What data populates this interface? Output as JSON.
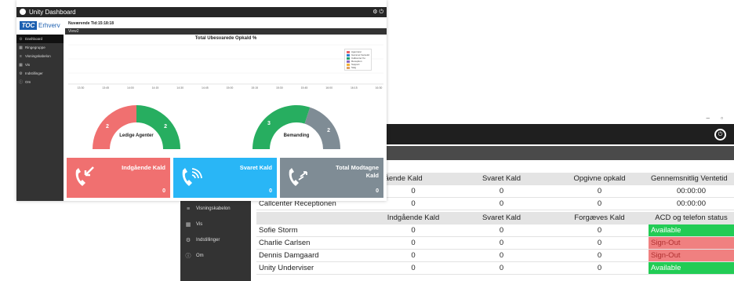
{
  "back_window": {
    "window_controls": "–   ▫",
    "sidebar": [
      {
        "icon": "≡",
        "label": "Visningskabelon"
      },
      {
        "icon": "▦",
        "label": "Vis"
      },
      {
        "icon": "⚙",
        "label": "Indstillinger"
      },
      {
        "icon": "ⓘ",
        "label": "Om"
      }
    ],
    "queue_table": {
      "headers": [
        "",
        "ngående Kald",
        "Svaret Kald",
        "Opgivne opkald",
        "Gennemsnitlig Ventetid"
      ],
      "rows": [
        [
          "",
          "0",
          "0",
          "0",
          "00:00:00"
        ],
        [
          "Callcenter Receptionen",
          "0",
          "0",
          "0",
          "00:00:00"
        ]
      ]
    },
    "agent_table": {
      "headers": [
        "",
        "Indgående Kald",
        "Svaret Kald",
        "Forgæves Kald",
        "ACD og telefon status"
      ],
      "rows": [
        {
          "name": "Sofie Storm",
          "in": "0",
          "answered": "0",
          "missed": "0",
          "status": "Available"
        },
        {
          "name": "Charlie Carlsen",
          "in": "0",
          "answered": "0",
          "missed": "0",
          "status": "Sign-Out"
        },
        {
          "name": "Dennis Damgaard",
          "in": "0",
          "answered": "0",
          "missed": "0",
          "status": "Sign-Out"
        },
        {
          "name": "Unity Underviser",
          "in": "0",
          "answered": "0",
          "missed": "0",
          "status": "Available"
        }
      ]
    }
  },
  "front_window": {
    "title": "Unity Dashboard",
    "logo": {
      "mark": "TOC",
      "text": "Erhverv"
    },
    "time_label": "Nuværende Tid:15:18:18",
    "view_label": "View2",
    "sidebar": [
      {
        "icon": "⊙",
        "label": "Dashboard"
      },
      {
        "icon": "▦",
        "label": "Ringegruppe"
      },
      {
        "icon": "≡",
        "label": "Visningskabelon"
      },
      {
        "icon": "▦",
        "label": "Vis"
      },
      {
        "icon": "⚙",
        "label": "Indstillinger"
      },
      {
        "icon": "ⓘ",
        "label": "Om"
      }
    ],
    "chart_title": "Total Ubesvarede Opkald %",
    "x_ticks": [
      "13:30",
      "13:45",
      "14:00",
      "14:15",
      "14:30",
      "14:45",
      "15:00",
      "15:15",
      "15:30",
      "15:45",
      "16:00",
      "16:15",
      "16:30"
    ],
    "legend": [
      {
        "label": "Agenturer",
        "color": "#e8656a"
      },
      {
        "label": "Gammel Ventetid",
        "color": "#2a7fd4"
      },
      {
        "label": "Callcenter Ko",
        "color": "#22a06b"
      },
      {
        "label": "Reception",
        "color": "#8a6bbf"
      },
      {
        "label": "Support",
        "color": "#f2b134"
      },
      {
        "label": "Salg",
        "color": "#e0a060"
      }
    ],
    "gauges": [
      {
        "label": "Ledige Agenter",
        "left": "2",
        "right": "2",
        "left_color": "#f07070",
        "right_color": "#27ae60",
        "fraction_left": 0.5
      },
      {
        "label": "Bemanding",
        "left": "3",
        "right": "2",
        "left_color": "#27ae60",
        "right_color": "#7f8c95",
        "fraction_left": 0.6
      }
    ],
    "cards": [
      {
        "title": "Indgående Kald",
        "value": "0",
        "color": "#f07070"
      },
      {
        "title": "Svaret Kald",
        "value": "0",
        "color": "#29b6f6"
      },
      {
        "title": "Total Modtagne\nKald",
        "value": "0",
        "color": "#7f8c95"
      }
    ]
  }
}
